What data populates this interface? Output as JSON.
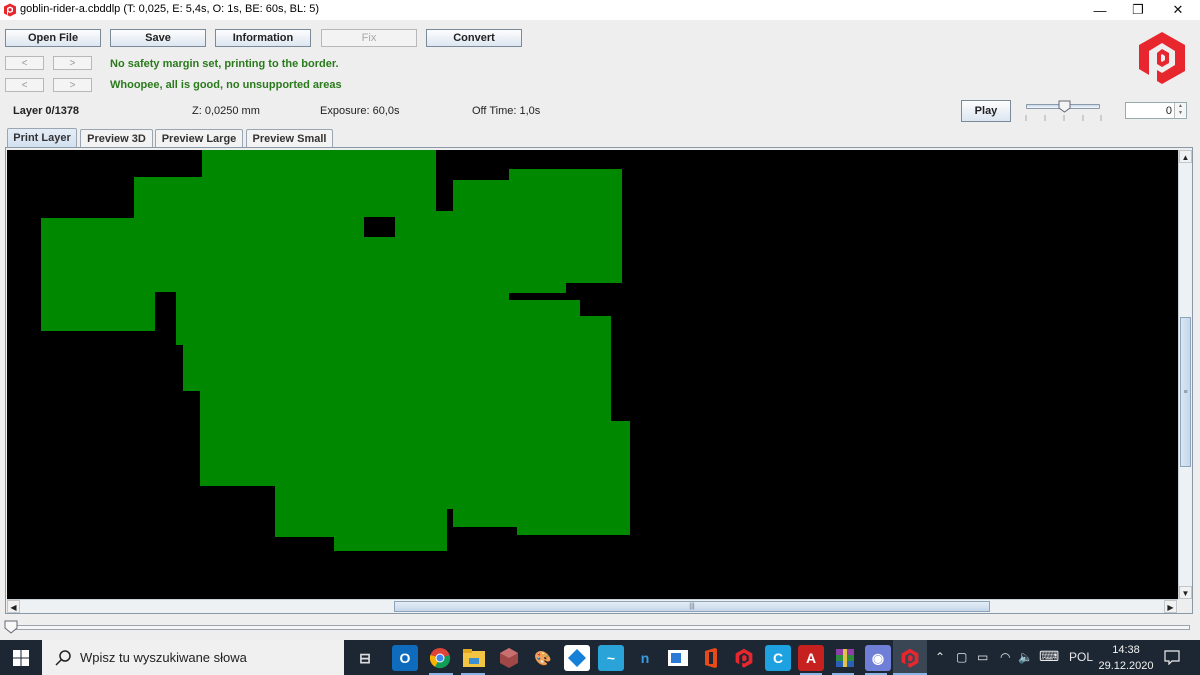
{
  "window": {
    "title": "goblin-rider-a.cbddlp (T: 0,025, E: 5,4s, O: 1s, BE: 60s, BL: 5)",
    "controls": {
      "minimize": "—",
      "maximize": "❐",
      "close": "✕"
    }
  },
  "toolbar": {
    "open_file": "Open File",
    "save": "Save",
    "information": "Information",
    "fix": "Fix",
    "convert": "Convert"
  },
  "navigation": {
    "prev": "<",
    "next": ">"
  },
  "messages": {
    "safety_margin": "No safety margin set, printing to the border.",
    "supports": "Whoopee, all is good, no unsupported areas"
  },
  "layer_info": {
    "layer": "Layer 0/1378",
    "z": "Z: 0,0250 mm",
    "exposure": "Exposure: 60,0s",
    "off_time": "Off Time: 1,0s"
  },
  "playback": {
    "play_label": "Play",
    "speed_slider_fraction": 0.5,
    "spinner_value": "0"
  },
  "tabs": [
    {
      "label": "Print Layer",
      "active": true
    },
    {
      "label": "Preview 3D",
      "active": false
    },
    {
      "label": "Preview Large",
      "active": false
    },
    {
      "label": "Preview Small",
      "active": false
    }
  ],
  "preview": {
    "background_color": "#000000",
    "layer_color": "#008800",
    "horizontal_scroll_fraction": 0.33,
    "vertical_scroll_fraction": 0.37
  },
  "layer_slider": {
    "current": 0,
    "max": 1378
  },
  "colors": {
    "accent_red": "#e8262d",
    "message_green": "#2a7a1c"
  },
  "taskbar": {
    "search_placeholder": "Wpisz tu wyszukiwane słowa",
    "apps": [
      {
        "name": "task-view",
        "glyph": "⊞"
      },
      {
        "name": "outlook",
        "glyph": "O"
      },
      {
        "name": "chrome",
        "glyph": "●"
      },
      {
        "name": "file-explorer",
        "glyph": "▬"
      },
      {
        "name": "3d-app",
        "glyph": "⬢"
      },
      {
        "name": "paint",
        "glyph": "🎨"
      },
      {
        "name": "app-diamond",
        "glyph": "◆"
      },
      {
        "name": "app-wave",
        "glyph": "~"
      },
      {
        "name": "app-n",
        "glyph": "n"
      },
      {
        "name": "app-window",
        "glyph": "▣"
      },
      {
        "name": "office",
        "glyph": "O"
      },
      {
        "name": "chitubox",
        "glyph": "P"
      },
      {
        "name": "app-c",
        "glyph": "C"
      },
      {
        "name": "acrobat",
        "glyph": "A"
      },
      {
        "name": "winrar",
        "glyph": "▤"
      },
      {
        "name": "discord",
        "glyph": "◉"
      },
      {
        "name": "chitubox-active",
        "glyph": "P"
      }
    ],
    "tray": {
      "language": "POL",
      "time": "14:38",
      "date": "29.12.2020"
    }
  }
}
